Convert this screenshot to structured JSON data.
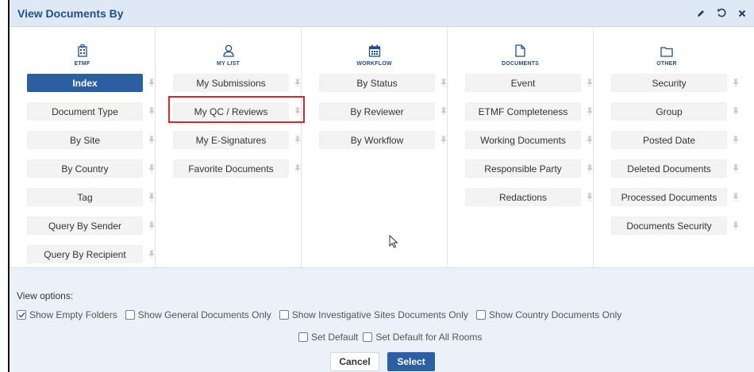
{
  "dialog": {
    "title": "View Documents By"
  },
  "columns": [
    {
      "caption": "ETMF",
      "icon": "building-icon",
      "items": [
        "Index",
        "Document Type",
        "By Site",
        "By Country",
        "Tag",
        "Query By Sender",
        "Query By Recipient"
      ],
      "active_index": 0
    },
    {
      "caption": "MY LIST",
      "icon": "user-icon",
      "items": [
        "My Submissions",
        "My QC / Reviews",
        "My E-Signatures",
        "Favorite Documents"
      ],
      "highlighted_index": 1
    },
    {
      "caption": "WORKFLOW",
      "icon": "calendar-icon",
      "items": [
        "By Status",
        "By Reviewer",
        "By Workflow"
      ]
    },
    {
      "caption": "DOCUMENTS",
      "icon": "document-icon",
      "items": [
        "Event",
        "ETMF Completeness",
        "Working Documents",
        "Responsible Party",
        "Redactions"
      ]
    },
    {
      "caption": "OTHER",
      "icon": "folder-icon",
      "items": [
        "Security",
        "Group",
        "Posted Date",
        "Deleted Documents",
        "Processed Documents",
        "Documents Security"
      ]
    }
  ],
  "options": {
    "label": "View options:",
    "checks": [
      {
        "label": "Show Empty Folders",
        "checked": true
      },
      {
        "label": "Show General Documents Only",
        "checked": false
      },
      {
        "label": "Show Investigative Sites Documents Only",
        "checked": false
      },
      {
        "label": "Show Country Documents Only",
        "checked": false
      }
    ],
    "set_default": {
      "label": "Set Default",
      "checked": false
    },
    "set_default_all": {
      "label": "Set Default for All Rooms",
      "checked": false
    }
  },
  "buttons": {
    "cancel": "Cancel",
    "select": "Select"
  },
  "colors": {
    "accent": "#2b5ea2",
    "title_text": "#1f4e8c",
    "highlight": "#d9281f",
    "options_bg": "#eaf1f8"
  }
}
